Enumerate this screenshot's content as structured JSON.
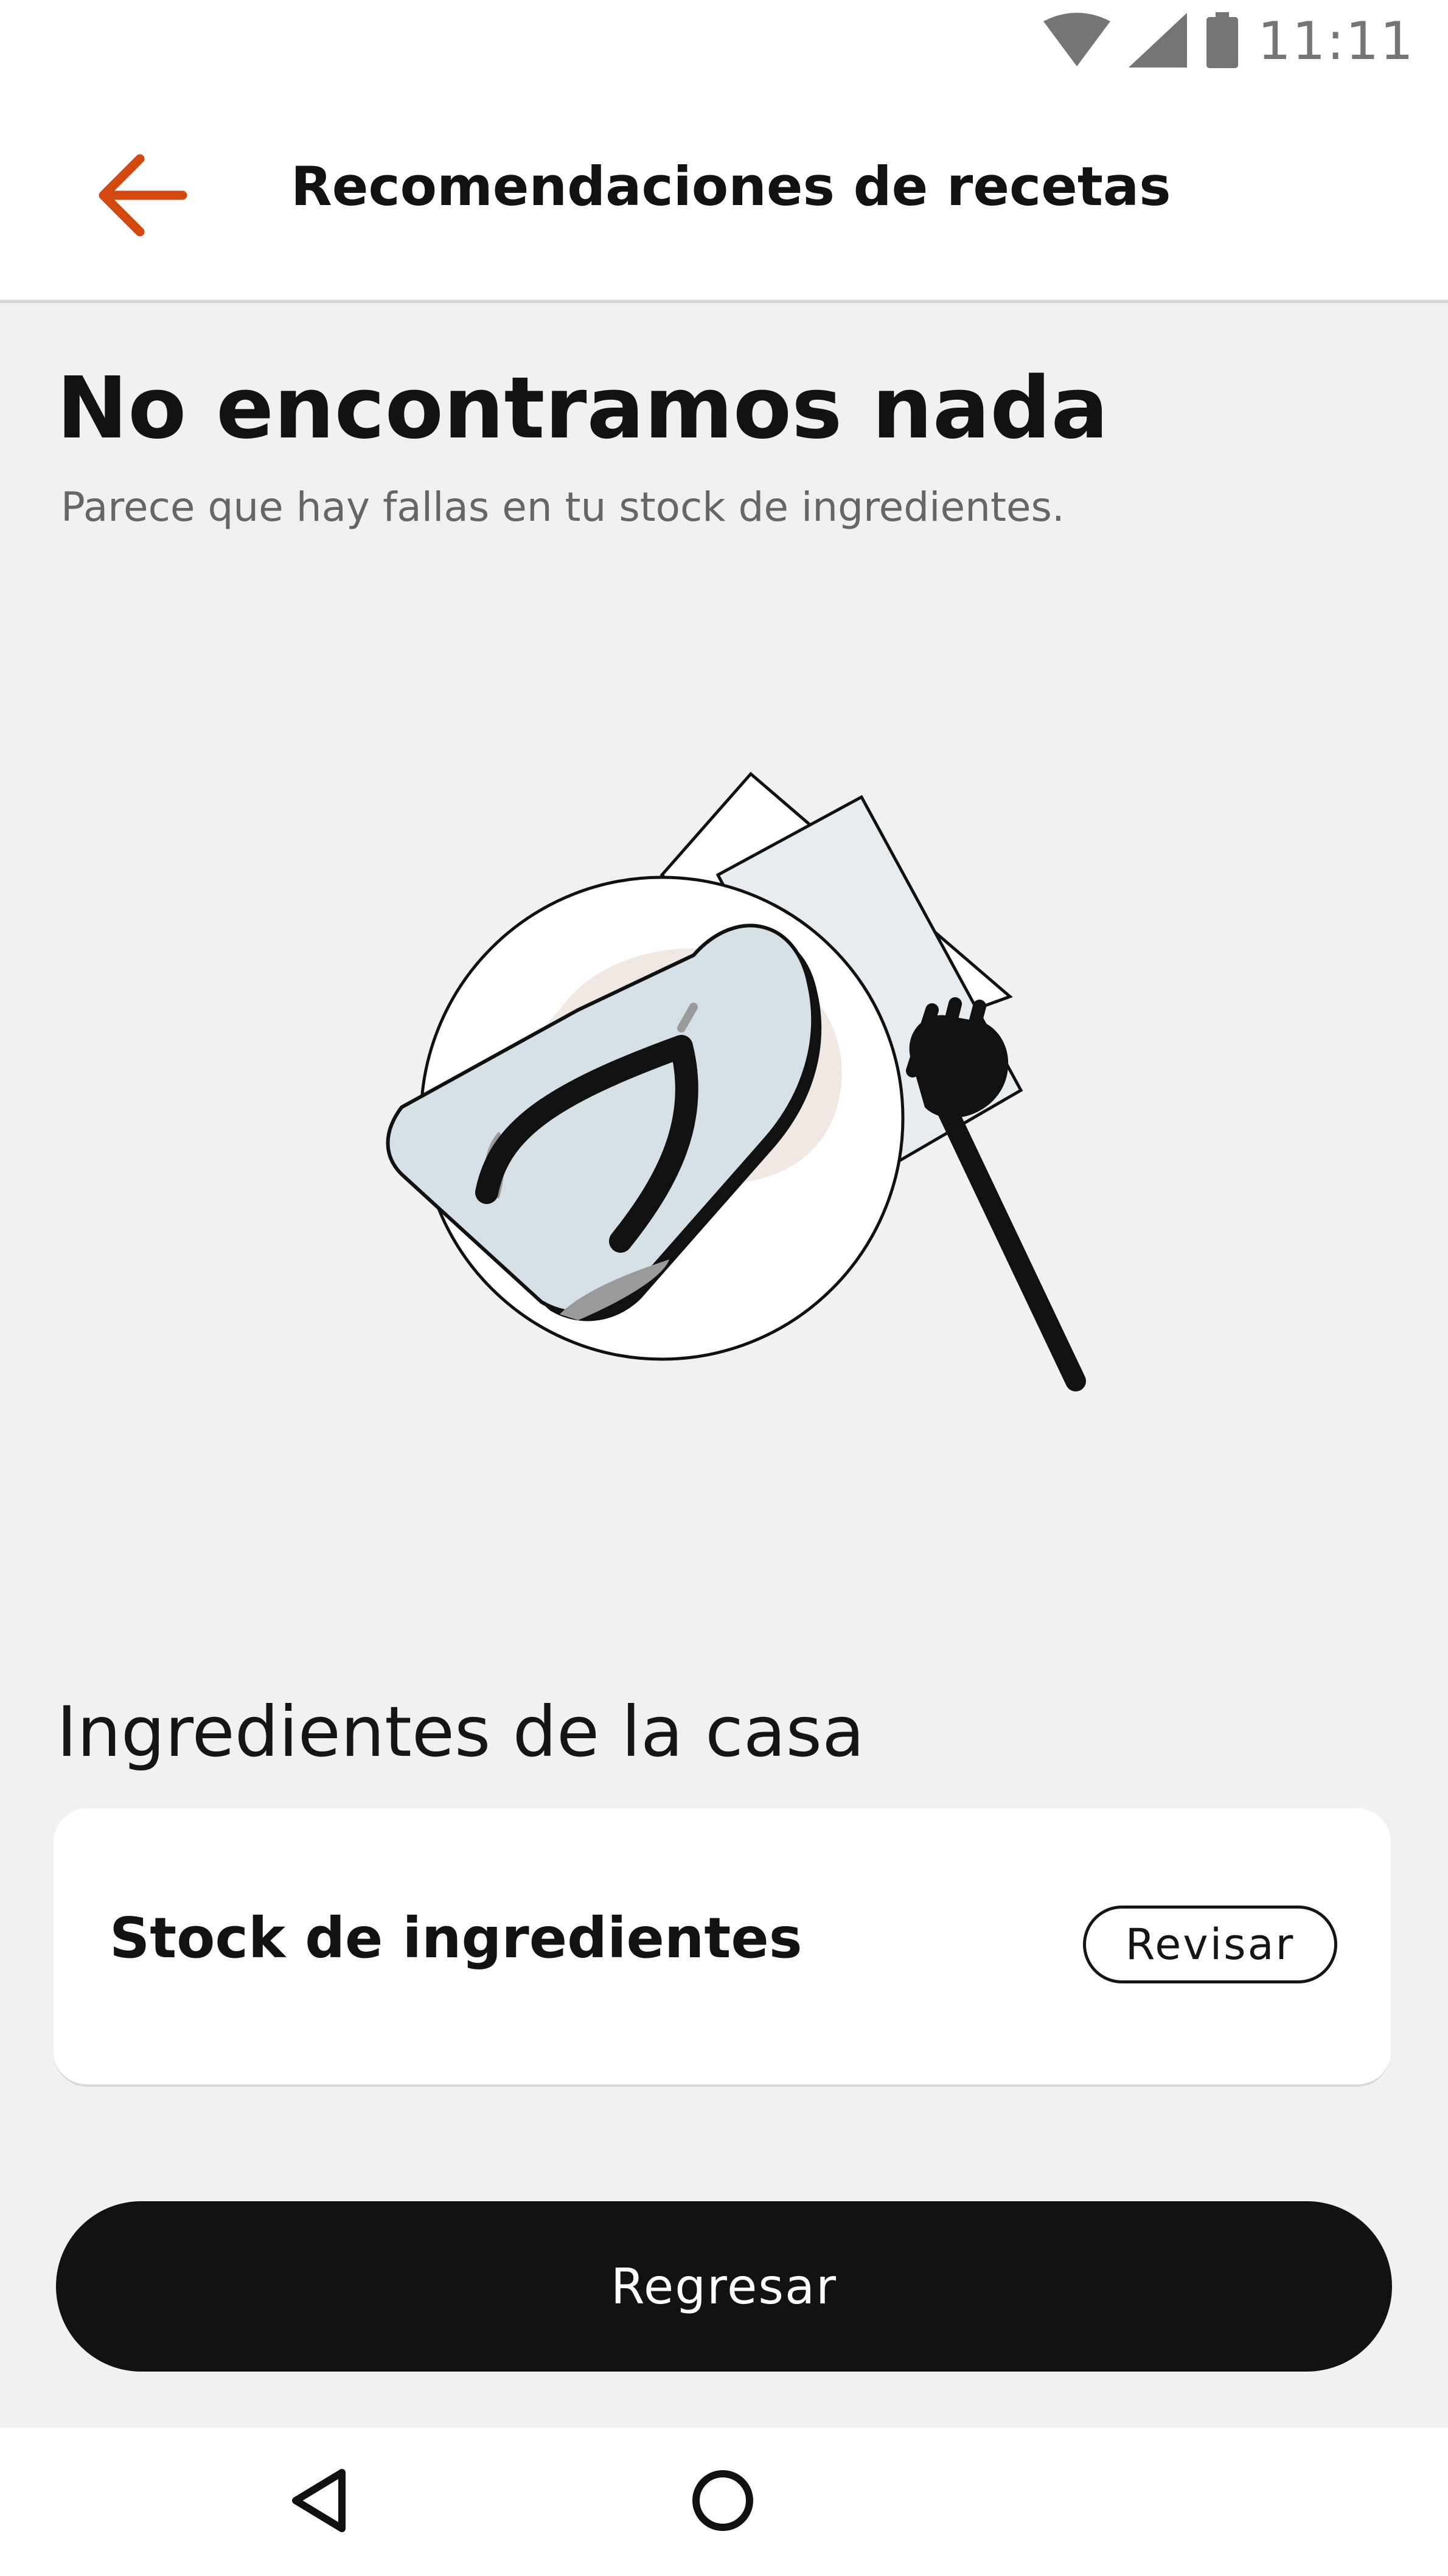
{
  "status_bar": {
    "time": "11:11",
    "icons": [
      "wifi-icon",
      "cell-signal-icon",
      "battery-icon"
    ]
  },
  "app_bar": {
    "title": "Recomendaciones de recetas",
    "back_icon": "arrow-left-icon"
  },
  "empty_state": {
    "title": "No encontramos nada",
    "subtitle": "Parece que hay fallas en tu stock de ingredientes.",
    "illustration": "flip-flop-on-plate-illustration"
  },
  "section": {
    "title": "Ingredientes de la casa"
  },
  "stock_card": {
    "label": "Stock de ingredientes",
    "action_label": "Revisar"
  },
  "primary_action": {
    "label": "Regresar"
  },
  "nav_bar": {
    "icons": [
      "nav-back-icon",
      "nav-home-icon"
    ]
  },
  "colors": {
    "accent": "#D2480F",
    "background": "#F1F1F1",
    "button": "#121212",
    "surface": "#FFFFFF"
  }
}
